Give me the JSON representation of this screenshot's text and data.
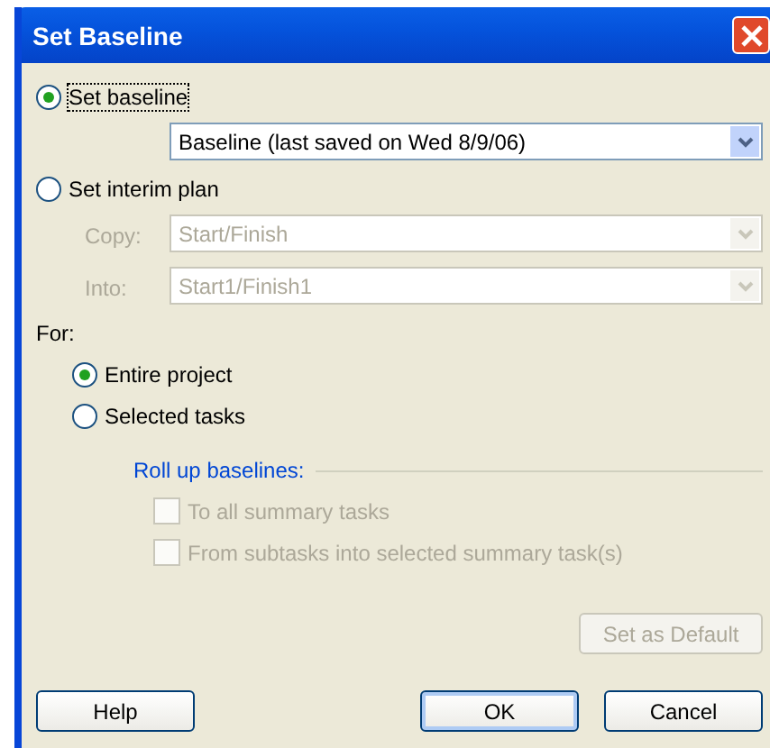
{
  "window": {
    "title": "Set Baseline"
  },
  "mode_options": [
    {
      "label": "Set baseline",
      "selected": true
    },
    {
      "label": "Set interim plan",
      "selected": false
    }
  ],
  "baseline_select": {
    "value": "Baseline (last saved on Wed 8/9/06)"
  },
  "interim_fields": [
    {
      "label": "Copy:",
      "value": "Start/Finish",
      "disabled": true
    },
    {
      "label": "Into:",
      "value": "Start1/Finish1",
      "disabled": true
    }
  ],
  "for_label": "For:",
  "scope_options": [
    {
      "label": "Entire project",
      "selected": true
    },
    {
      "label": "Selected tasks",
      "selected": false
    }
  ],
  "rollup": {
    "title": "Roll up baselines:",
    "options": [
      {
        "label": "To all summary tasks",
        "checked": false,
        "disabled": true
      },
      {
        "label": "From subtasks into selected summary task(s)",
        "checked": false,
        "disabled": true
      }
    ]
  },
  "default_button": {
    "label": "Set as Default",
    "disabled": true
  },
  "buttons": [
    {
      "label": "Help",
      "kind": "left"
    },
    {
      "label": "OK",
      "kind": "right"
    },
    {
      "label": "Cancel",
      "kind": "right"
    }
  ]
}
